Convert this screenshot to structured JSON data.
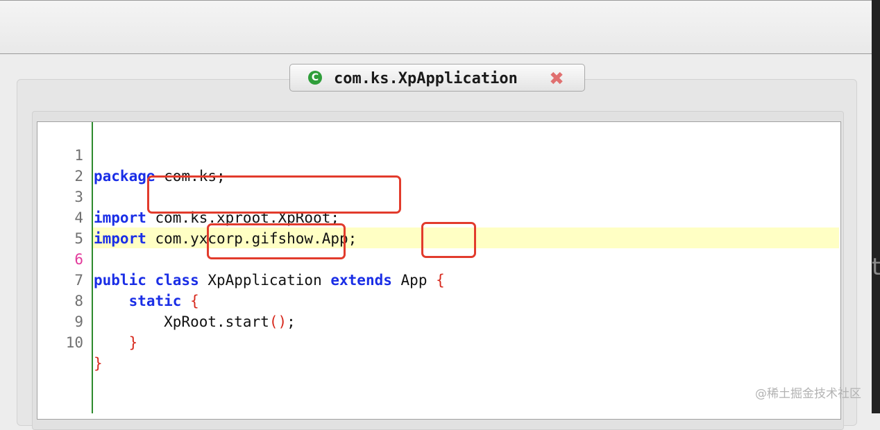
{
  "tab": {
    "title": "com.ks.XpApplication",
    "icon": "class-c-icon",
    "icon_glyph": "C",
    "close_glyph": "✖"
  },
  "editor": {
    "current_line": 6,
    "lines": [
      {
        "num": "1",
        "parts": [
          "package",
          " com.ks;"
        ]
      },
      {
        "num": "2",
        "parts": []
      },
      {
        "num": "3",
        "parts": [
          "import",
          " com.ks.xproot.XpRoot;"
        ]
      },
      {
        "num": "4",
        "parts": [
          "import",
          " com.yxcorp.gifshow.App;"
        ]
      },
      {
        "num": "5",
        "parts": []
      },
      {
        "num": "6",
        "parts": [
          "public class",
          " XpApplication ",
          "extends",
          " App ",
          "{"
        ]
      },
      {
        "num": "7",
        "parts": [
          "    ",
          "static",
          " ",
          "{"
        ]
      },
      {
        "num": "8",
        "parts": [
          "        XpRoot.start",
          "()",
          ";"
        ]
      },
      {
        "num": "9",
        "parts": [
          "    ",
          "}"
        ]
      },
      {
        "num": "10",
        "parts": [
          "}"
        ]
      }
    ]
  },
  "side_glyph": "t",
  "watermark": "@稀土掘金技术社区",
  "colors": {
    "keyword": "#1a2ee6",
    "brace": "#d7281c",
    "current_line_bg": "#ffffc4",
    "annotation_box": "#e23b2c",
    "gutter_marker": "#2c8a2c"
  }
}
